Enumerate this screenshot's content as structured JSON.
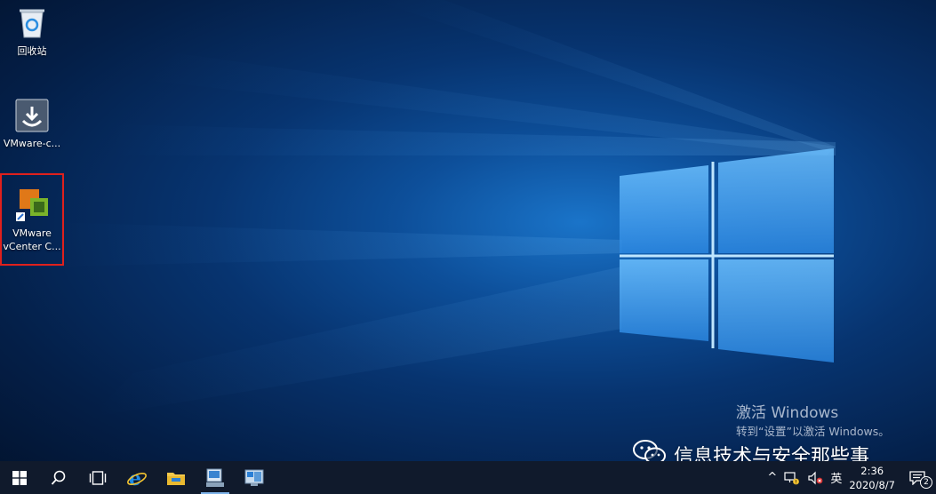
{
  "desktop": {
    "icons": [
      {
        "label": "回收站",
        "icon": "recycle-bin-icon"
      },
      {
        "label": "VMware-c...",
        "icon": "vmware-installer-icon"
      },
      {
        "label_line1": "VMware",
        "label_line2": "vCenter C...",
        "icon": "vmware-vcenter-icon",
        "selected": true
      }
    ]
  },
  "watermark": {
    "line1": "激活 Windows",
    "line2": "转到“设置”以激活 Windows。"
  },
  "brand": {
    "text": "信息技术与安全那些事",
    "icon": "wechat-icon"
  },
  "taskbar": {
    "items": [
      "start-icon",
      "search-icon",
      "task-view-icon",
      "internet-explorer-icon",
      "file-explorer-icon",
      "server-manager-icon",
      "vsphere-client-icon"
    ],
    "tray": {
      "chevron": "^",
      "ime": "英",
      "time": "2:36",
      "date": "2020/8/7",
      "notification_count": "2"
    }
  },
  "colors": {
    "selection_outline": "#e0201c",
    "taskbar_bg": "#101a2c",
    "accent": "#7fb4ea"
  }
}
